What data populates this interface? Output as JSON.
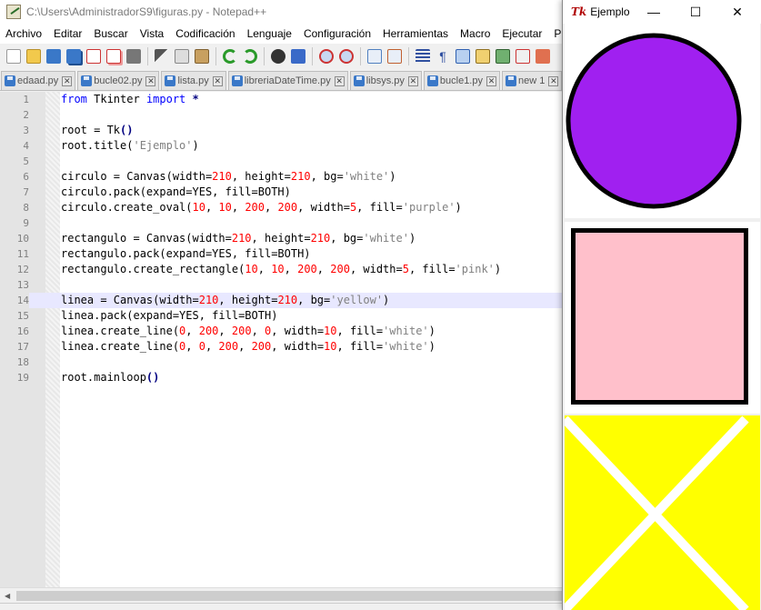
{
  "notepad": {
    "title": "C:\\Users\\AdministradorS9\\figuras.py - Notepad++",
    "menu": [
      "Archivo",
      "Editar",
      "Buscar",
      "Vista",
      "Codificación",
      "Lenguaje",
      "Configuración",
      "Herramientas",
      "Macro",
      "Ejecutar",
      "P"
    ],
    "tabs": [
      "edaad.py",
      "bucle02.py",
      "lista.py",
      "libreriaDateTime.py",
      "libsys.py",
      "bucle1.py",
      "new 1"
    ],
    "line_numbers": [
      "1",
      "2",
      "3",
      "4",
      "5",
      "6",
      "7",
      "8",
      "9",
      "10",
      "11",
      "12",
      "13",
      "14",
      "15",
      "16",
      "17",
      "18",
      "19"
    ],
    "current_line": 14,
    "code": {
      "l1": {
        "a": "from",
        "b": " Tkinter ",
        "c": "import",
        "d": " *"
      },
      "l3": {
        "a": "root = Tk",
        "b": "()"
      },
      "l4": {
        "a": "root.title(",
        "b": "'Ejemplo'",
        "c": ")"
      },
      "l6": {
        "a": "circulo = Canvas(width=",
        "b": "210",
        "c": ", height=",
        "d": "210",
        "e": ", bg=",
        "f": "'white'",
        "g": ")"
      },
      "l7": {
        "a": "circulo.pack(expand=YES, fill=BOTH)"
      },
      "l8": {
        "a": "circulo.create_oval(",
        "b": "10",
        "c": ", ",
        "d": "10",
        "e": ", ",
        "f": "200",
        "g": ", ",
        "h": "200",
        "i": ", width=",
        "j": "5",
        "k": ", fill=",
        "l": "'purple'",
        "m": ")"
      },
      "l10": {
        "a": "rectangulo = Canvas(width=",
        "b": "210",
        "c": ", height=",
        "d": "210",
        "e": ", bg=",
        "f": "'white'",
        "g": ")"
      },
      "l11": {
        "a": "rectangulo.pack(expand=YES, fill=BOTH)"
      },
      "l12": {
        "a": "rectangulo.create_rectangle(",
        "b": "10",
        "c": ", ",
        "d": "10",
        "e": ", ",
        "f": "200",
        "g": ", ",
        "h": "200",
        "i": ", width=",
        "j": "5",
        "k": ", fill=",
        "l": "'pink'",
        "m": ")"
      },
      "l14": {
        "a": "linea = Canvas(width=",
        "b": "210",
        "c": ", height=",
        "d": "210",
        "e": ", bg=",
        "f": "'yellow'",
        "g": ")"
      },
      "l15": {
        "a": "linea.pack(expand=YES, fill=BOTH)"
      },
      "l16": {
        "a": "linea.create_line(",
        "b": "0",
        "c": ", ",
        "d": "200",
        "e": ", ",
        "f": "200",
        "g": ", ",
        "h": "0",
        "i": ", width=",
        "j": "10",
        "k": ", fill=",
        "l": "'white'",
        "m": ")"
      },
      "l17": {
        "a": "linea.create_line(",
        "b": "0",
        "c": ", ",
        "d": "0",
        "e": ", ",
        "f": "200",
        "g": ", ",
        "h": "200",
        "i": ", width=",
        "j": "10",
        "k": ", fill=",
        "l": "'white'",
        "m": ")"
      },
      "l19": {
        "a": "root.mainloop",
        "b": "()"
      }
    }
  },
  "tk_window": {
    "icon_label": "Tk",
    "title": "Ejemplo",
    "minimize": "—",
    "maximize": "☐",
    "close": "✕",
    "shapes": {
      "circle_fill": "#a020f0",
      "rect_fill": "#ffc0cb",
      "lines_bg": "#ffff00",
      "lines_color": "#ffffff"
    }
  }
}
